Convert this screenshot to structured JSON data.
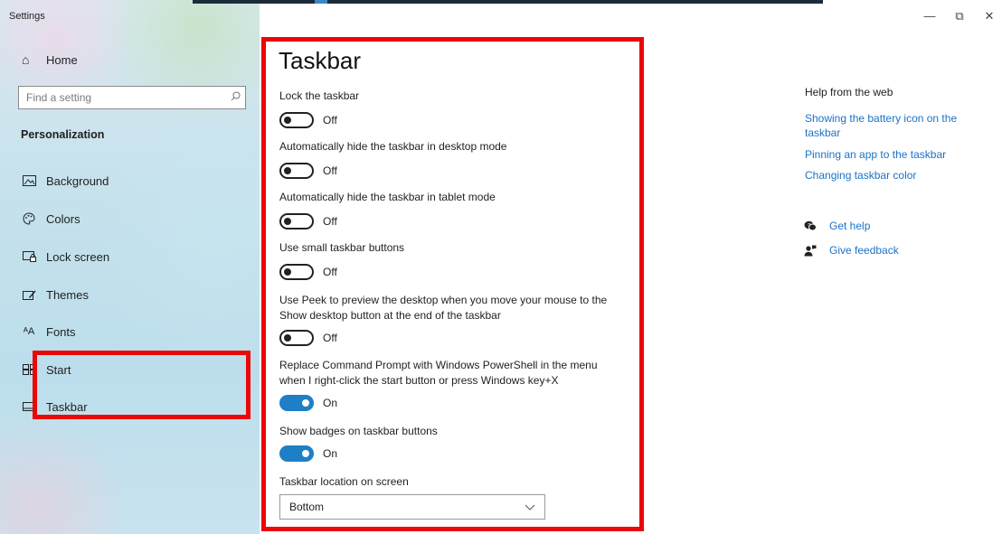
{
  "window": {
    "title": "Settings",
    "controls": {
      "minimize": "—",
      "restore": "⧉",
      "close": "✕"
    }
  },
  "sidebar": {
    "home_label": "Home",
    "search_placeholder": "Find a setting",
    "section_title": "Personalization",
    "items": [
      {
        "label": "Background",
        "icon": "background-icon"
      },
      {
        "label": "Colors",
        "icon": "colors-icon"
      },
      {
        "label": "Lock screen",
        "icon": "lock-screen-icon"
      },
      {
        "label": "Themes",
        "icon": "themes-icon"
      },
      {
        "label": "Fonts",
        "icon": "fonts-icon"
      },
      {
        "label": "Start",
        "icon": "start-icon"
      },
      {
        "label": "Taskbar",
        "icon": "taskbar-icon"
      }
    ]
  },
  "main": {
    "title": "Taskbar",
    "settings": [
      {
        "label": "Lock the taskbar",
        "state": "Off",
        "on": false
      },
      {
        "label": "Automatically hide the taskbar in desktop mode",
        "state": "Off",
        "on": false
      },
      {
        "label": "Automatically hide the taskbar in tablet mode",
        "state": "Off",
        "on": false
      },
      {
        "label": "Use small taskbar buttons",
        "state": "Off",
        "on": false
      },
      {
        "label": "Use Peek to preview the desktop when you move your mouse to the Show desktop button at the end of the taskbar",
        "state": "Off",
        "on": false
      },
      {
        "label": "Replace Command Prompt with Windows PowerShell in the menu when I right-click the start button or press Windows key+X",
        "state": "On",
        "on": true
      },
      {
        "label": "Show badges on taskbar buttons",
        "state": "On",
        "on": true
      }
    ],
    "location_label": "Taskbar location on screen",
    "location_value": "Bottom"
  },
  "help": {
    "title": "Help from the web",
    "links": [
      "Showing the battery icon on the taskbar",
      "Pinning an app to the taskbar",
      "Changing taskbar color"
    ],
    "get_help": "Get help",
    "give_feedback": "Give feedback"
  },
  "colors": {
    "accent": "#1e7ec6",
    "link": "#1a73c7",
    "highlight": "#ea0707"
  }
}
